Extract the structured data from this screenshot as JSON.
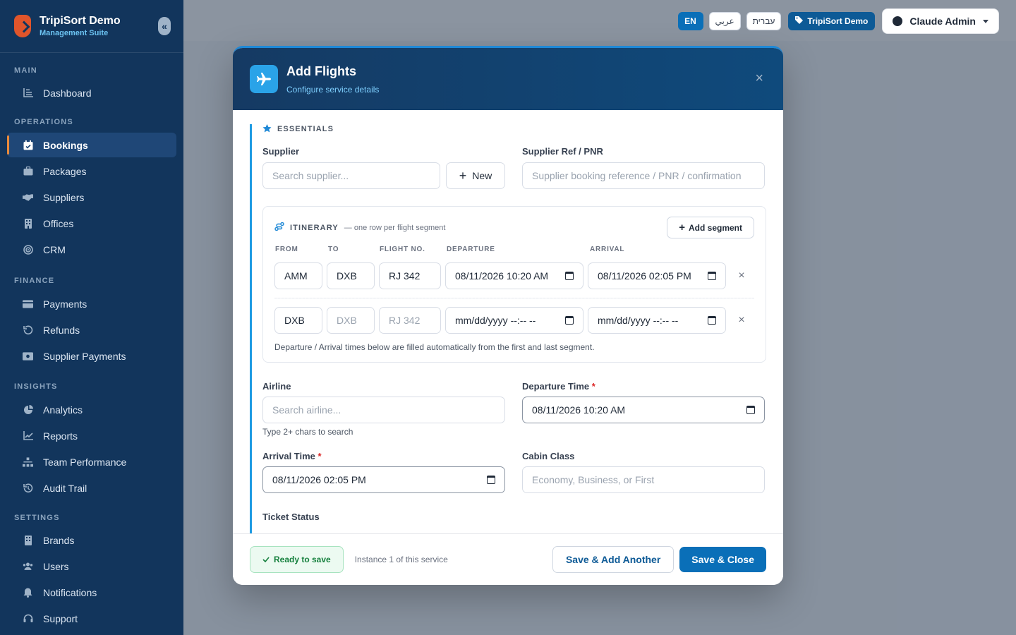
{
  "sidebar": {
    "brand_name": "TripiSort Demo",
    "brand_sub": "Management Suite",
    "sections": {
      "main": "MAIN",
      "operations": "OPERATIONS",
      "finance": "FINANCE",
      "insights": "INSIGHTS",
      "settings": "SETTINGS"
    },
    "items": {
      "dashboard": "Dashboard",
      "bookings": "Bookings",
      "packages": "Packages",
      "suppliers": "Suppliers",
      "offices": "Offices",
      "crm": "CRM",
      "payments": "Payments",
      "refunds": "Refunds",
      "supplier_payments": "Supplier Payments",
      "analytics": "Analytics",
      "reports": "Reports",
      "team_performance": "Team Performance",
      "audit_trail": "Audit Trail",
      "brands": "Brands",
      "users": "Users",
      "notifications": "Notifications",
      "support": "Support"
    }
  },
  "topbar": {
    "lang_en": "EN",
    "lang_ar": "عربي",
    "lang_he": "עברית",
    "brand_chip": "TripiSort Demo",
    "user": "Claude Admin"
  },
  "modal": {
    "title": "Add Flights",
    "subtitle": "Configure service details",
    "close": "×",
    "section_title": "ESSENTIALS",
    "supplier_label": "Supplier",
    "supplier_placeholder": "Search supplier...",
    "new_button": "New",
    "supplier_ref_label": "Supplier Ref / PNR",
    "supplier_ref_placeholder": "Supplier booking reference / PNR / confirmation",
    "itinerary": {
      "title": "ITINERARY",
      "note": "— one row per flight segment",
      "add_segment": "Add segment",
      "columns": {
        "from": "FROM",
        "to": "TO",
        "flight": "FLIGHT NO.",
        "departure": "DEPARTURE",
        "arrival": "ARRIVAL"
      },
      "segments": [
        {
          "from": "AMM",
          "to": "DXB",
          "flight": "RJ 342",
          "departure": "08/11/2026 10:20  AM",
          "arrival": "08/11/2026 02:05  PM"
        },
        {
          "from": "DXB",
          "to": "DXB",
          "flight": "RJ 342",
          "departure": "mm/dd/yyyy --:-- --",
          "arrival": "mm/dd/yyyy --:-- --"
        }
      ],
      "hint": "Departure / Arrival times below are filled automatically from the first and last segment."
    },
    "airline_label": "Airline",
    "airline_placeholder": "Search airline...",
    "airline_hint": "Type 2+ chars to search",
    "departure_label": "Departure Time",
    "departure_value": "08/11/2026 10:20  AM",
    "arrival_label": "Arrival Time",
    "arrival_value": "08/11/2026 02:05  PM",
    "cabin_label": "Cabin Class",
    "cabin_placeholder": "Economy, Business, or First",
    "ticket_status_label": "Ticket Status",
    "required_mark": "*"
  },
  "footer": {
    "ready": "Ready to save",
    "instance": "Instance 1 of this service",
    "save_add": "Save & Add Another",
    "save_close": "Save & Close"
  }
}
